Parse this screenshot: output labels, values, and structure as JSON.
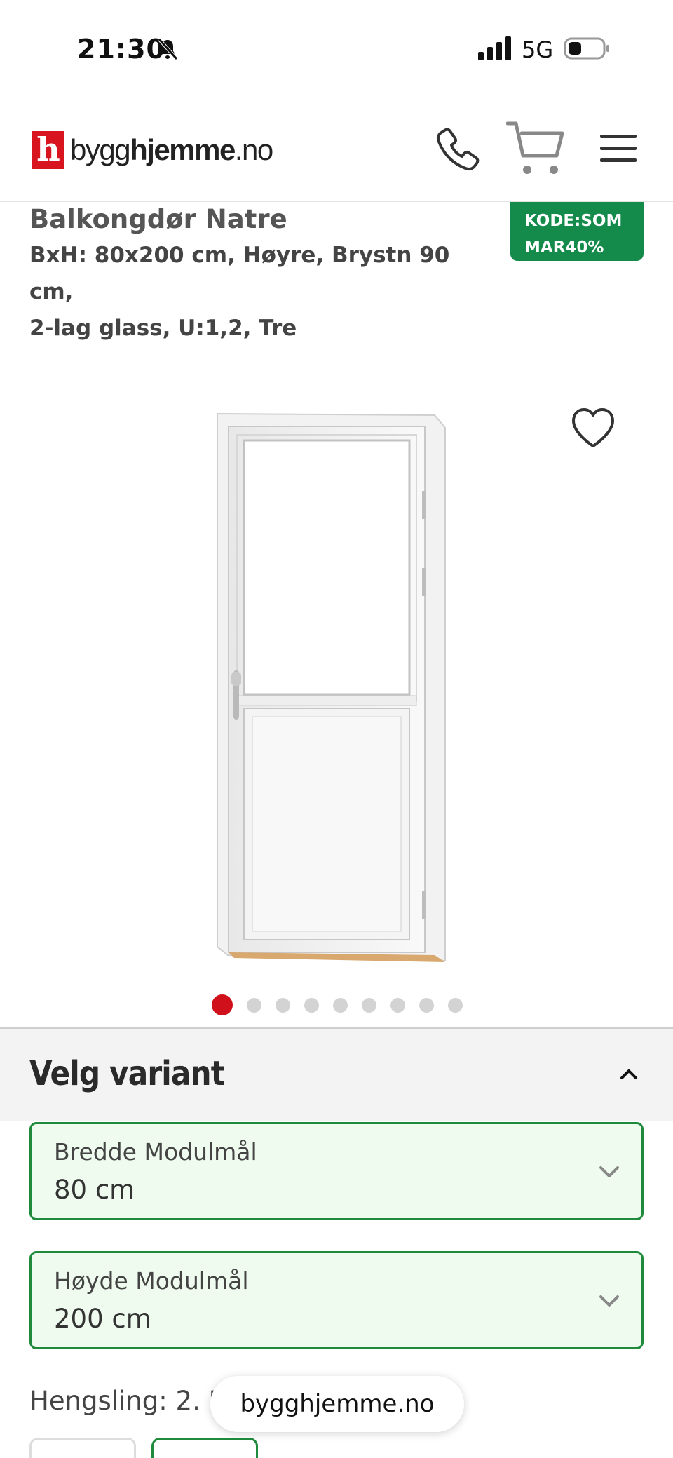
{
  "status_bar": {
    "time": "21:30",
    "network": "5G"
  },
  "header": {
    "logo_mark": "h",
    "logo_text_a": "bygg",
    "logo_text_b": "hjemme",
    "logo_text_c": ".no"
  },
  "product": {
    "title": "Balkongdør Natre",
    "subtitle_line1": "BxH: 80x200 cm, Høyre, Brystn 90 cm,",
    "subtitle_line2": "2-lag glass, U:1,2, Tre",
    "promo_line1": "KODE:SOM",
    "promo_line2": "MAR40%",
    "image_count": 9,
    "active_image_index": 0
  },
  "variant": {
    "section_title": "Velg variant",
    "width_select": {
      "label": "Bredde Modulmål",
      "value": "80 cm"
    },
    "height_select": {
      "label": "Høyde Modulmål",
      "value": "200 cm"
    },
    "hengsling_label": "Hengsling: 2. I"
  },
  "browser": {
    "url": "bygghjemme.no"
  },
  "colors": {
    "accent_red": "#d0101b",
    "badge_green": "#148a4b",
    "select_border": "#1f8a3c"
  }
}
